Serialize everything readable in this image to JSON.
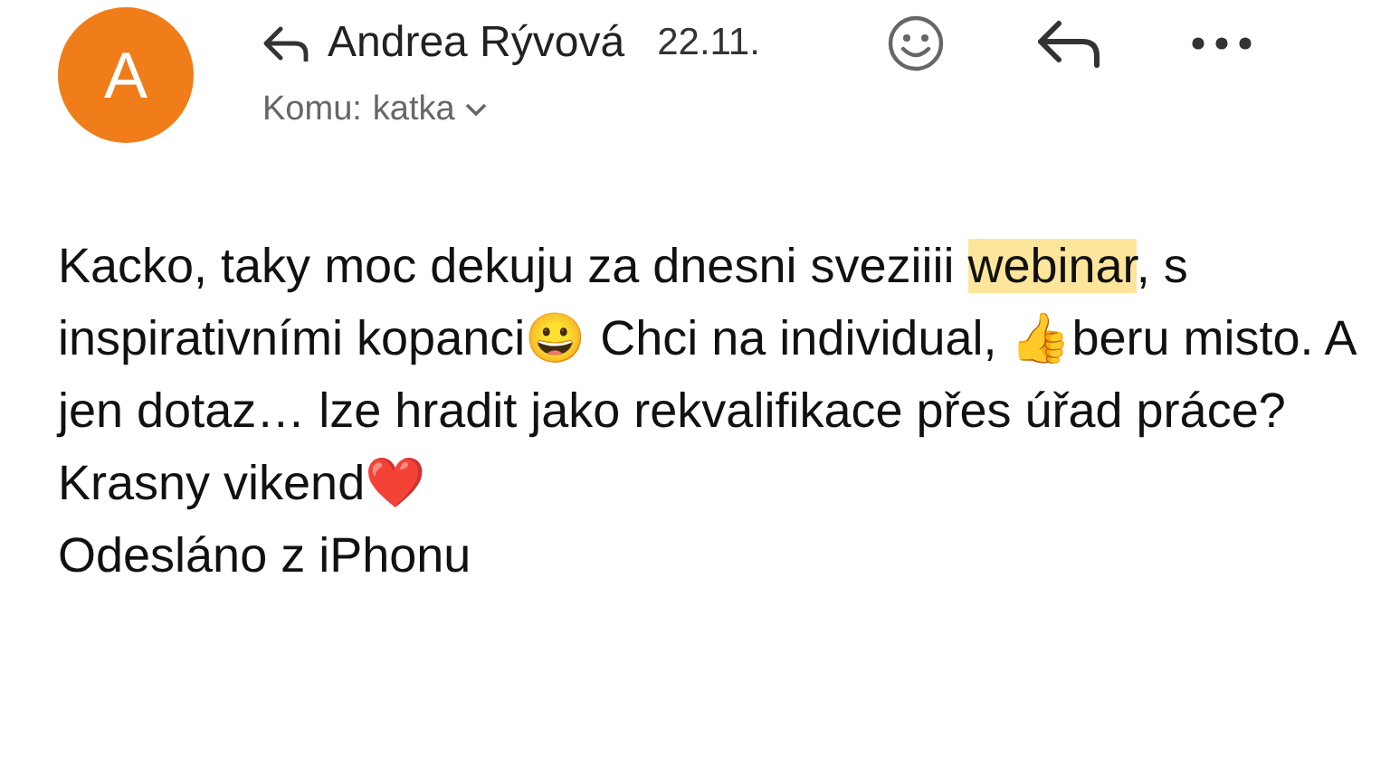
{
  "message": {
    "avatar_letter": "A",
    "sender": "Andrea Rývová",
    "date": "22.11.",
    "recipient_label": "Komu:",
    "recipient": "katka",
    "body": [
      {
        "text": "Kacko, taky moc dekuju za dnesni sveziiii ",
        "highlighted": false
      },
      {
        "text": "webinar",
        "highlighted": true
      },
      {
        "text": ", s inspirativními kopanci😀 Chci na individual, 👍beru misto. A jen dotaz… lze hradit jako rekvalifikace přes úřad práce? Krasny vikend❤️",
        "highlighted": false
      }
    ],
    "signature": "Odesláno z iPhonu"
  }
}
